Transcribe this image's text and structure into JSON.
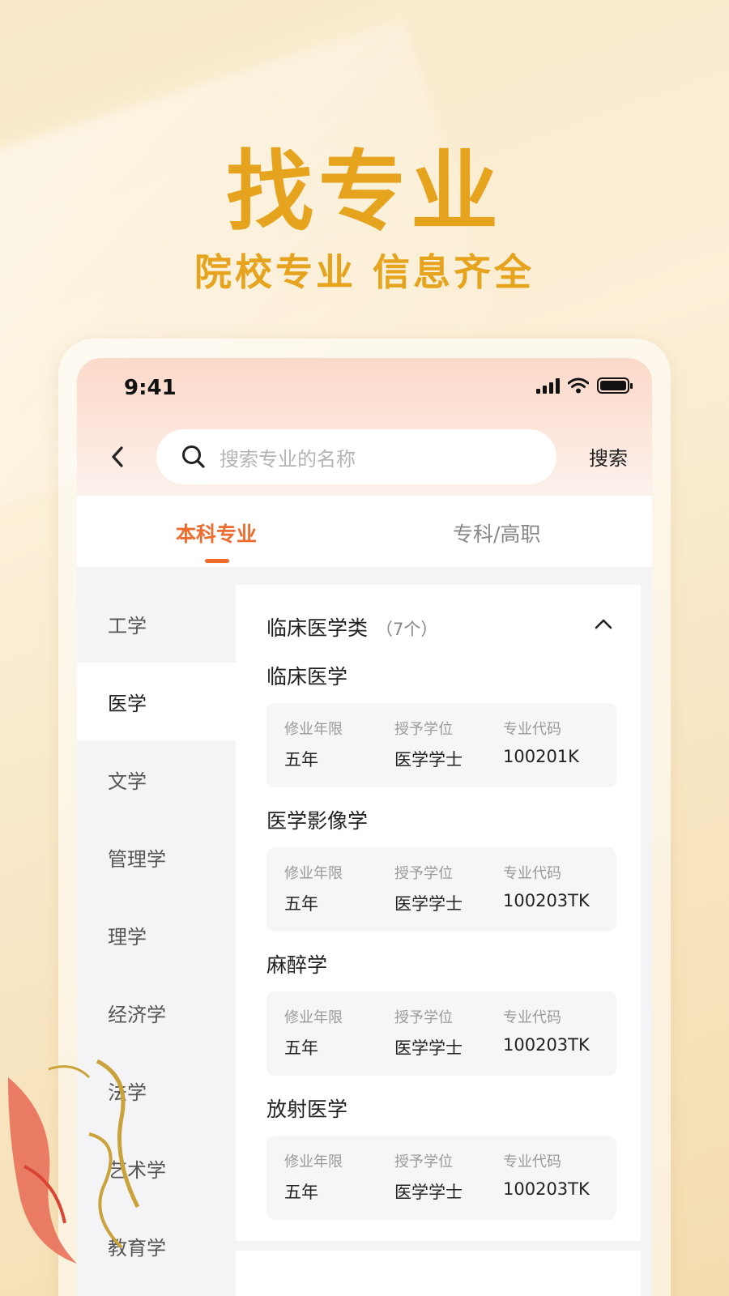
{
  "hero": {
    "title": "找专业",
    "subtitle": "院校专业 信息齐全"
  },
  "status_bar": {
    "time": "9:41"
  },
  "search": {
    "placeholder": "搜索专业的名称",
    "button_label": "搜索"
  },
  "tabs": [
    {
      "label": "本科专业",
      "active": true
    },
    {
      "label": "专科/高职",
      "active": false
    }
  ],
  "sidebar": {
    "items": [
      {
        "label": "工学",
        "active": false
      },
      {
        "label": "医学",
        "active": true
      },
      {
        "label": "文学",
        "active": false
      },
      {
        "label": "管理学",
        "active": false
      },
      {
        "label": "理学",
        "active": false
      },
      {
        "label": "经济学",
        "active": false
      },
      {
        "label": "法学",
        "active": false
      },
      {
        "label": "艺术学",
        "active": false
      },
      {
        "label": "教育学",
        "active": false
      }
    ]
  },
  "category": {
    "name": "临床医学类",
    "count": "（7个）"
  },
  "field_labels": {
    "duration": "修业年限",
    "degree": "授予学位",
    "code": "专业代码"
  },
  "majors": [
    {
      "name": "临床医学",
      "duration": "五年",
      "degree": "医学学士",
      "code": "100201K"
    },
    {
      "name": "医学影像学",
      "duration": "五年",
      "degree": "医学学士",
      "code": "100203TK"
    },
    {
      "name": "麻醉学",
      "duration": "五年",
      "degree": "医学学士",
      "code": "100203TK"
    },
    {
      "name": "放射医学",
      "duration": "五年",
      "degree": "医学学士",
      "code": "100203TK"
    }
  ],
  "colors": {
    "accent": "#ee6b2d",
    "hero": "#e6a31e"
  }
}
